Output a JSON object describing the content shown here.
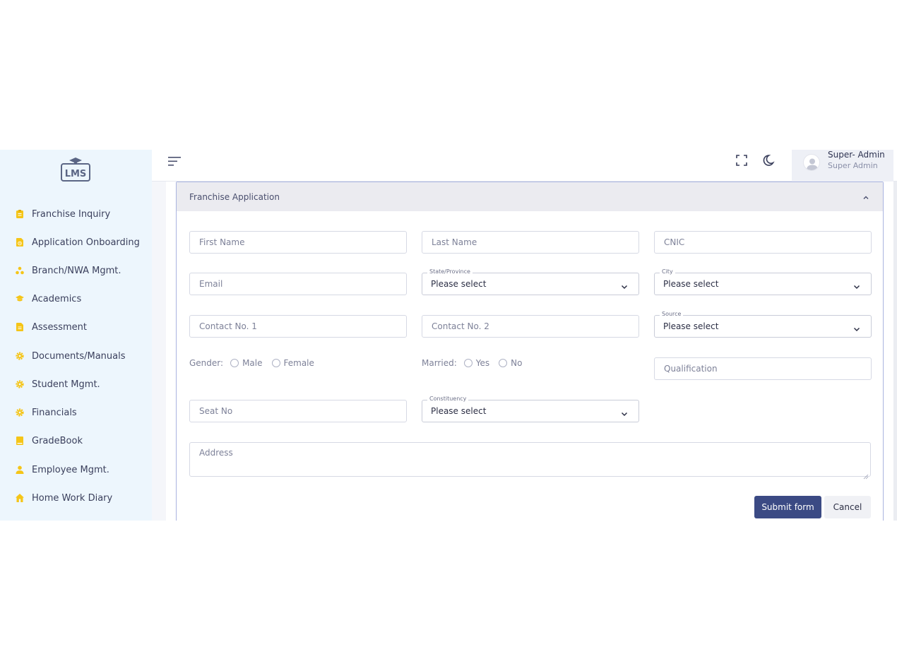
{
  "app": {
    "logo_text": "LMS"
  },
  "sidebar": {
    "items": [
      {
        "label": "Franchise Inquiry",
        "icon": "clipboard-icon"
      },
      {
        "label": "Application Onboarding",
        "icon": "document-clock-icon"
      },
      {
        "label": "Branch/NWA Mgmt.",
        "icon": "network-icon"
      },
      {
        "label": "Academics",
        "icon": "graduation-cap-icon"
      },
      {
        "label": "Assessment",
        "icon": "file-icon"
      },
      {
        "label": "Documents/Manuals",
        "icon": "gear-icon"
      },
      {
        "label": "Student Mgmt.",
        "icon": "gear-icon"
      },
      {
        "label": "Financials",
        "icon": "gear-icon"
      },
      {
        "label": "GradeBook",
        "icon": "book-icon"
      },
      {
        "label": "Employee Mgmt.",
        "icon": "user-icon"
      },
      {
        "label": "Home Work Diary",
        "icon": "home-icon"
      }
    ],
    "icon_color": "#f5c518"
  },
  "header": {
    "user_name": "Super- Admin",
    "user_role": "Super Admin"
  },
  "form": {
    "title": "Franchise Application",
    "first_name_placeholder": "First Name",
    "last_name_placeholder": "Last Name",
    "cnic_placeholder": "CNIC",
    "email_placeholder": "Email",
    "state_label": "State/Province",
    "state_value": "Please select",
    "city_label": "City",
    "city_value": "Please select",
    "contact1_placeholder": "Contact No. 1",
    "contact2_placeholder": "Contact No. 2",
    "source_label": "Source",
    "source_value": "Please select",
    "gender_label": "Gender:",
    "gender_options": [
      "Male",
      "Female"
    ],
    "married_label": "Married:",
    "married_options": [
      "Yes",
      "No"
    ],
    "qualification_placeholder": "Qualification",
    "seat_no_placeholder": "Seat No",
    "constituency_label": "Constituency",
    "constituency_value": "Please select",
    "address_placeholder": "Address",
    "submit_label": "Submit form",
    "cancel_label": "Cancel"
  },
  "colors": {
    "primary": "#3b4a84",
    "sidebar_bg": "#edf6fd",
    "card_border": "#aab4e0"
  }
}
